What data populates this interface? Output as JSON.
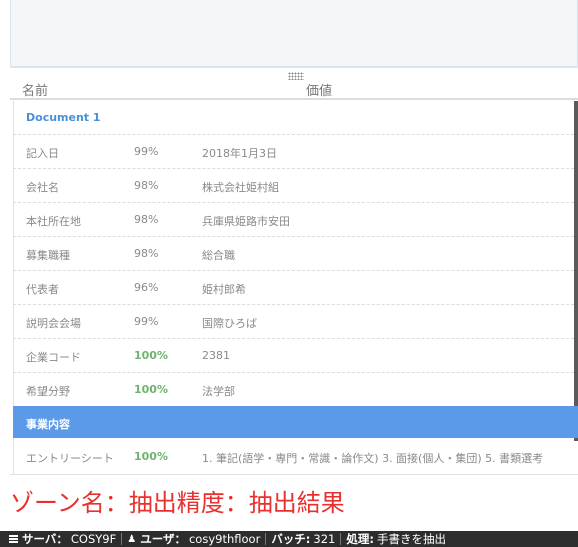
{
  "headers": {
    "name": "名前",
    "value": "価値"
  },
  "document": {
    "title": "Document 1"
  },
  "rows": [
    {
      "name": "記入日",
      "accuracy": "99%",
      "value": "2018年1月3日"
    },
    {
      "name": "会社名",
      "accuracy": "98%",
      "value": "株式会社姫村組"
    },
    {
      "name": "本社所在地",
      "accuracy": "98%",
      "value": "兵庫県姫路市安田"
    },
    {
      "name": "募集職種",
      "accuracy": "98%",
      "value": "総合職"
    },
    {
      "name": "代表者",
      "accuracy": "96%",
      "value": "姫村郎希"
    },
    {
      "name": "説明会会場",
      "accuracy": "99%",
      "value": "国際ひろば"
    },
    {
      "name": "企業コード",
      "accuracy": "100%",
      "value": "2381"
    },
    {
      "name": "希望分野",
      "accuracy": "100%",
      "value": "法学部"
    }
  ],
  "section": {
    "label": "事業内容"
  },
  "entry_row": {
    "name": "エントリーシート",
    "accuracy": "100%",
    "value": "1. 筆記(語学・専門・常識・論作文) 3. 面接(個人・集団) 5. 書類選考"
  },
  "legend": "ゾーン名：抽出精度：抽出結果",
  "status_bar": {
    "server_label": "サーバ：",
    "server_value": "COSY9F",
    "user_label": "ユーザ：",
    "user_value": "cosy9thfloor",
    "batch_label": "バッチ:",
    "batch_value": "321",
    "process_label": "処理:",
    "process_value": "手書きを抽出"
  },
  "colors": {
    "accent": "#5b9ae8",
    "high_accuracy": "#6db36d",
    "legend": "#e8312f",
    "status_bar": "#2d2d2d"
  },
  "icons": {
    "server": "server-icon",
    "user": "user-icon",
    "grip": "drag-handle-icon"
  }
}
